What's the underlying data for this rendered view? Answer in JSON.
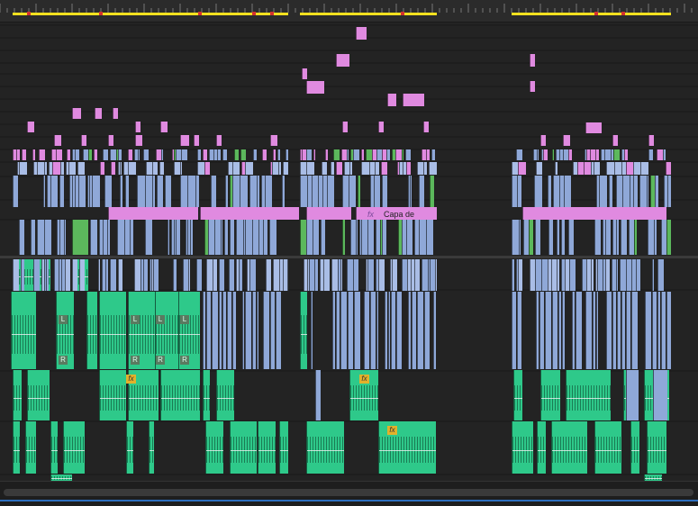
{
  "app": {
    "name": "Premiere timeline"
  },
  "colors": {
    "background": "#232323",
    "ruler_bar": "#f2e01f",
    "marker": "#d23030",
    "video_clip": "#8fa8d8",
    "adjustment_clip": "#e08ae0",
    "audio_clip": "#2ec98a",
    "fx_badge": "#e2b12b",
    "playhead_blue": "#2d6fbf"
  },
  "labels": {
    "adjustment_clip": "Capa de",
    "fx": "fx",
    "chip_r": "R",
    "chip_l": "L"
  },
  "icons": {
    "fx": "fx-badge-icon",
    "keyframe": "keyframe-icon"
  }
}
